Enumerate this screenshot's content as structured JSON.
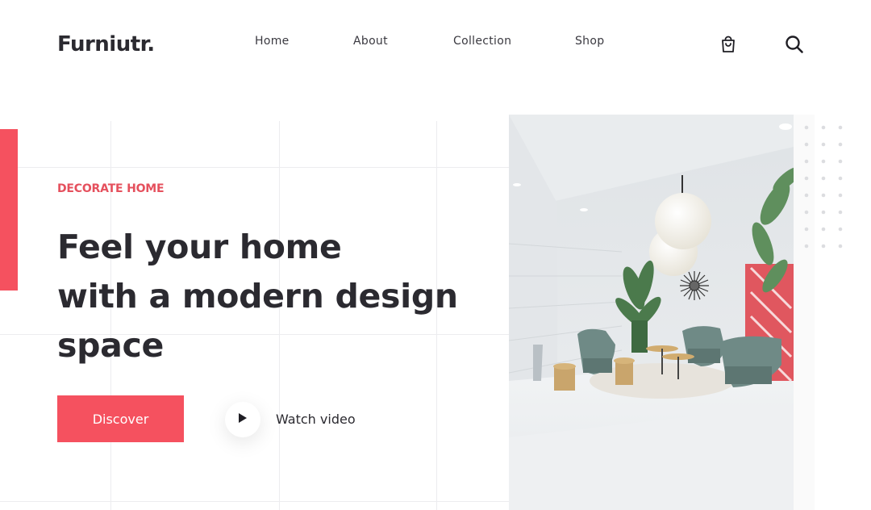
{
  "brand": {
    "logo": "Furniutr."
  },
  "nav": {
    "items": [
      "Home",
      "About",
      "Collection",
      "Shop"
    ]
  },
  "icons": {
    "cart": "shopping-bag-icon",
    "search": "search-icon",
    "play": "play-icon"
  },
  "hero": {
    "eyebrow": "DECORATE HOME",
    "headline_lines": [
      "Feel your home",
      "with a modern design",
      "space"
    ],
    "primary_button": "Discover",
    "video_link": "Watch video"
  },
  "colors": {
    "accent": "#f5515f",
    "eyebrow": "#e5505d",
    "text": "#2b2a30",
    "chair": "#6f8a86"
  }
}
